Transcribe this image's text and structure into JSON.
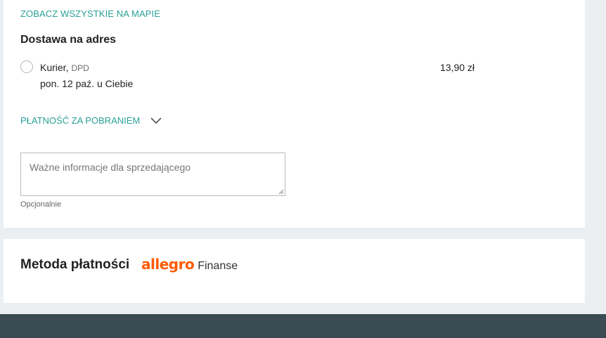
{
  "delivery": {
    "see_all_link": "ZOBACZ WSZYSTKIE NA MAPIE",
    "section_title": "Dostawa na adres",
    "option": {
      "name": "Kurier,",
      "carrier": "DPD",
      "date": "pon. 12 paź. u Ciebie",
      "price": "13,90 zł"
    },
    "cod_label": "PŁATNOŚĆ ZA POBRANIEM",
    "note_placeholder": "Ważne informacje dla sprzedającego",
    "note_hint": "Opcjonalnie"
  },
  "payment": {
    "title": "Metoda płatności",
    "brand": "allegro",
    "brand_suffix": "Finanse"
  },
  "colors": {
    "accent_teal": "#2aa197",
    "brand_orange": "#ff5a00",
    "footer": "#3b4b52",
    "page_bg": "#eceff1"
  },
  "icons": {
    "cod_toggle": "chevron-down-icon",
    "note_resize": "resize-grip-icon"
  }
}
